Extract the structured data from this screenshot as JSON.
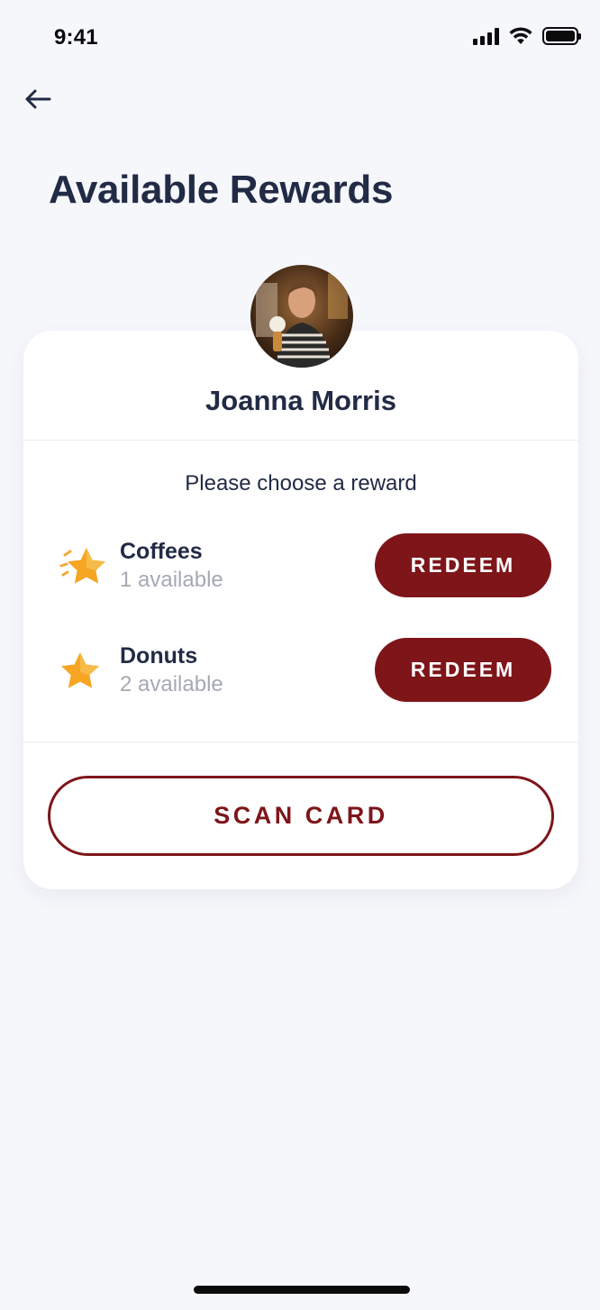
{
  "status_bar": {
    "time": "9:41",
    "icons": [
      "cellular-signal-icon",
      "wifi-icon",
      "battery-icon"
    ]
  },
  "header": {
    "back_icon": "arrow-left-icon",
    "title": "Available Rewards"
  },
  "profile": {
    "name": "Joanna Morris"
  },
  "rewards": {
    "prompt": "Please choose a reward",
    "items": [
      {
        "name": "Coffees",
        "availability": "1 available",
        "icon": "star-icon",
        "button_label": "REDEEM"
      },
      {
        "name": "Donuts",
        "availability": "2 available",
        "icon": "star-icon",
        "button_label": "REDEEM"
      }
    ]
  },
  "actions": {
    "scan_label": "SCAN CARD"
  },
  "colors": {
    "accent": "#7E1519",
    "title": "#222B45",
    "muted": "#A6A9B4",
    "background": "#F6F7FB",
    "star": "#F6A623"
  }
}
